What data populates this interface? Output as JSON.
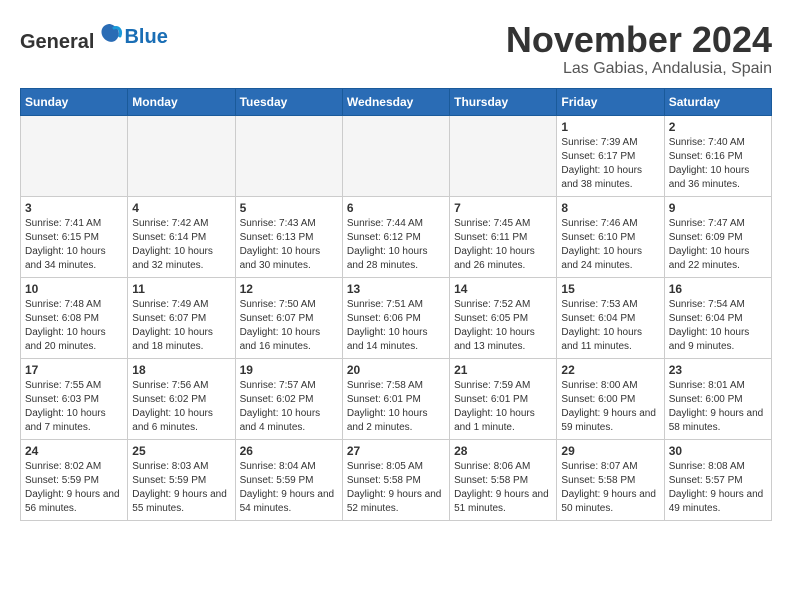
{
  "header": {
    "logo_general": "General",
    "logo_blue": "Blue",
    "month_title": "November 2024",
    "location": "Las Gabias, Andalusia, Spain"
  },
  "days_of_week": [
    "Sunday",
    "Monday",
    "Tuesday",
    "Wednesday",
    "Thursday",
    "Friday",
    "Saturday"
  ],
  "weeks": [
    [
      {
        "day": "",
        "info": ""
      },
      {
        "day": "",
        "info": ""
      },
      {
        "day": "",
        "info": ""
      },
      {
        "day": "",
        "info": ""
      },
      {
        "day": "",
        "info": ""
      },
      {
        "day": "1",
        "info": "Sunrise: 7:39 AM\nSunset: 6:17 PM\nDaylight: 10 hours and 38 minutes."
      },
      {
        "day": "2",
        "info": "Sunrise: 7:40 AM\nSunset: 6:16 PM\nDaylight: 10 hours and 36 minutes."
      }
    ],
    [
      {
        "day": "3",
        "info": "Sunrise: 7:41 AM\nSunset: 6:15 PM\nDaylight: 10 hours and 34 minutes."
      },
      {
        "day": "4",
        "info": "Sunrise: 7:42 AM\nSunset: 6:14 PM\nDaylight: 10 hours and 32 minutes."
      },
      {
        "day": "5",
        "info": "Sunrise: 7:43 AM\nSunset: 6:13 PM\nDaylight: 10 hours and 30 minutes."
      },
      {
        "day": "6",
        "info": "Sunrise: 7:44 AM\nSunset: 6:12 PM\nDaylight: 10 hours and 28 minutes."
      },
      {
        "day": "7",
        "info": "Sunrise: 7:45 AM\nSunset: 6:11 PM\nDaylight: 10 hours and 26 minutes."
      },
      {
        "day": "8",
        "info": "Sunrise: 7:46 AM\nSunset: 6:10 PM\nDaylight: 10 hours and 24 minutes."
      },
      {
        "day": "9",
        "info": "Sunrise: 7:47 AM\nSunset: 6:09 PM\nDaylight: 10 hours and 22 minutes."
      }
    ],
    [
      {
        "day": "10",
        "info": "Sunrise: 7:48 AM\nSunset: 6:08 PM\nDaylight: 10 hours and 20 minutes."
      },
      {
        "day": "11",
        "info": "Sunrise: 7:49 AM\nSunset: 6:07 PM\nDaylight: 10 hours and 18 minutes."
      },
      {
        "day": "12",
        "info": "Sunrise: 7:50 AM\nSunset: 6:07 PM\nDaylight: 10 hours and 16 minutes."
      },
      {
        "day": "13",
        "info": "Sunrise: 7:51 AM\nSunset: 6:06 PM\nDaylight: 10 hours and 14 minutes."
      },
      {
        "day": "14",
        "info": "Sunrise: 7:52 AM\nSunset: 6:05 PM\nDaylight: 10 hours and 13 minutes."
      },
      {
        "day": "15",
        "info": "Sunrise: 7:53 AM\nSunset: 6:04 PM\nDaylight: 10 hours and 11 minutes."
      },
      {
        "day": "16",
        "info": "Sunrise: 7:54 AM\nSunset: 6:04 PM\nDaylight: 10 hours and 9 minutes."
      }
    ],
    [
      {
        "day": "17",
        "info": "Sunrise: 7:55 AM\nSunset: 6:03 PM\nDaylight: 10 hours and 7 minutes."
      },
      {
        "day": "18",
        "info": "Sunrise: 7:56 AM\nSunset: 6:02 PM\nDaylight: 10 hours and 6 minutes."
      },
      {
        "day": "19",
        "info": "Sunrise: 7:57 AM\nSunset: 6:02 PM\nDaylight: 10 hours and 4 minutes."
      },
      {
        "day": "20",
        "info": "Sunrise: 7:58 AM\nSunset: 6:01 PM\nDaylight: 10 hours and 2 minutes."
      },
      {
        "day": "21",
        "info": "Sunrise: 7:59 AM\nSunset: 6:01 PM\nDaylight: 10 hours and 1 minute."
      },
      {
        "day": "22",
        "info": "Sunrise: 8:00 AM\nSunset: 6:00 PM\nDaylight: 9 hours and 59 minutes."
      },
      {
        "day": "23",
        "info": "Sunrise: 8:01 AM\nSunset: 6:00 PM\nDaylight: 9 hours and 58 minutes."
      }
    ],
    [
      {
        "day": "24",
        "info": "Sunrise: 8:02 AM\nSunset: 5:59 PM\nDaylight: 9 hours and 56 minutes."
      },
      {
        "day": "25",
        "info": "Sunrise: 8:03 AM\nSunset: 5:59 PM\nDaylight: 9 hours and 55 minutes."
      },
      {
        "day": "26",
        "info": "Sunrise: 8:04 AM\nSunset: 5:59 PM\nDaylight: 9 hours and 54 minutes."
      },
      {
        "day": "27",
        "info": "Sunrise: 8:05 AM\nSunset: 5:58 PM\nDaylight: 9 hours and 52 minutes."
      },
      {
        "day": "28",
        "info": "Sunrise: 8:06 AM\nSunset: 5:58 PM\nDaylight: 9 hours and 51 minutes."
      },
      {
        "day": "29",
        "info": "Sunrise: 8:07 AM\nSunset: 5:58 PM\nDaylight: 9 hours and 50 minutes."
      },
      {
        "day": "30",
        "info": "Sunrise: 8:08 AM\nSunset: 5:57 PM\nDaylight: 9 hours and 49 minutes."
      }
    ]
  ]
}
